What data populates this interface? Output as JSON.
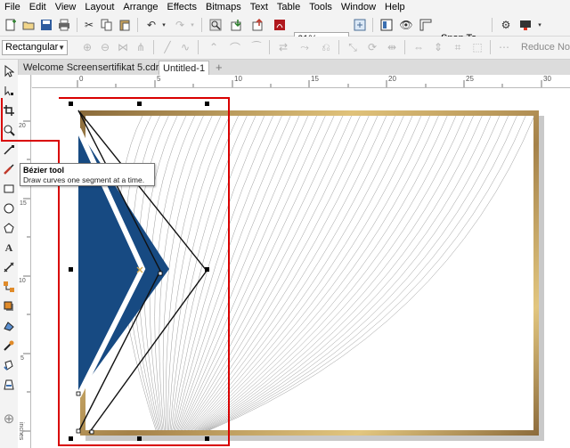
{
  "menu": [
    "File",
    "Edit",
    "View",
    "Layout",
    "Arrange",
    "Effects",
    "Bitmaps",
    "Text",
    "Table",
    "Tools",
    "Window",
    "Help"
  ],
  "toolbar": {
    "zoom_value": "61%",
    "snap_label": "Snap To"
  },
  "property_bar": {
    "mode_value": "Rectangular",
    "reduce_nodes_label": "Reduce Node"
  },
  "tabs": [
    "Welcome Screen",
    "sertifikat 5.cdr",
    "Untitled-1"
  ],
  "ruler": {
    "h_ticks": [
      "0",
      "5",
      "10",
      "15",
      "20",
      "25",
      "30"
    ],
    "v_ticks": [
      "20",
      "15",
      "10",
      "5"
    ],
    "unit": "inches"
  },
  "tooltip": {
    "title": "Bézier tool",
    "body": "Draw curves one segment at a time."
  },
  "colors": {
    "accent_red": "#d90000",
    "navy": "#174a82",
    "gold": "#b8955a"
  },
  "icons": [
    "new-icon",
    "open-icon",
    "save-icon",
    "print-icon",
    "cut-icon",
    "copy-icon",
    "paste-icon",
    "undo-icon",
    "redo-icon",
    "search-content-icon",
    "import-icon",
    "export-icon",
    "publish-pdf-icon",
    "app-launcher-icon",
    "full-screen-icon",
    "rulers-icon",
    "options-icon",
    "zoom-in-icon",
    "pick-tool-icon",
    "shape-tool-icon",
    "crop-tool-icon",
    "zoom-tool-icon",
    "freehand-tool-icon",
    "artistic-media-icon",
    "rectangle-tool-icon",
    "ellipse-tool-icon",
    "polygon-tool-icon",
    "text-tool-icon",
    "parallel-dimension-icon",
    "connector-icon",
    "drop-shadow-icon",
    "transparency-icon",
    "eyedropper-icon",
    "interactive-fill-icon",
    "smart-fill-icon",
    "add-tool-icon"
  ]
}
